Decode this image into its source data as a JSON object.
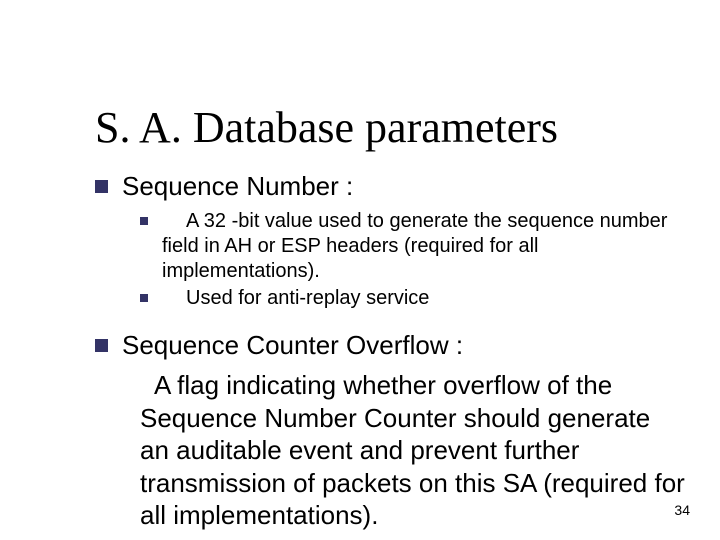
{
  "title": "S. A. Database parameters",
  "items": [
    {
      "label": "Sequence Number  :",
      "sub": [
        "A 32 -bit value used to generate the sequence number field in AH or ESP headers (required for all implementations).",
        "Used for anti-replay service"
      ]
    },
    {
      "label": "Sequence Counter Overflow :",
      "para": "A flag indicating whether overflow of the Sequence Number Counter should generate an auditable event and prevent further transmission of packets on this SA (required for all implementations)."
    }
  ],
  "page_number": "34"
}
